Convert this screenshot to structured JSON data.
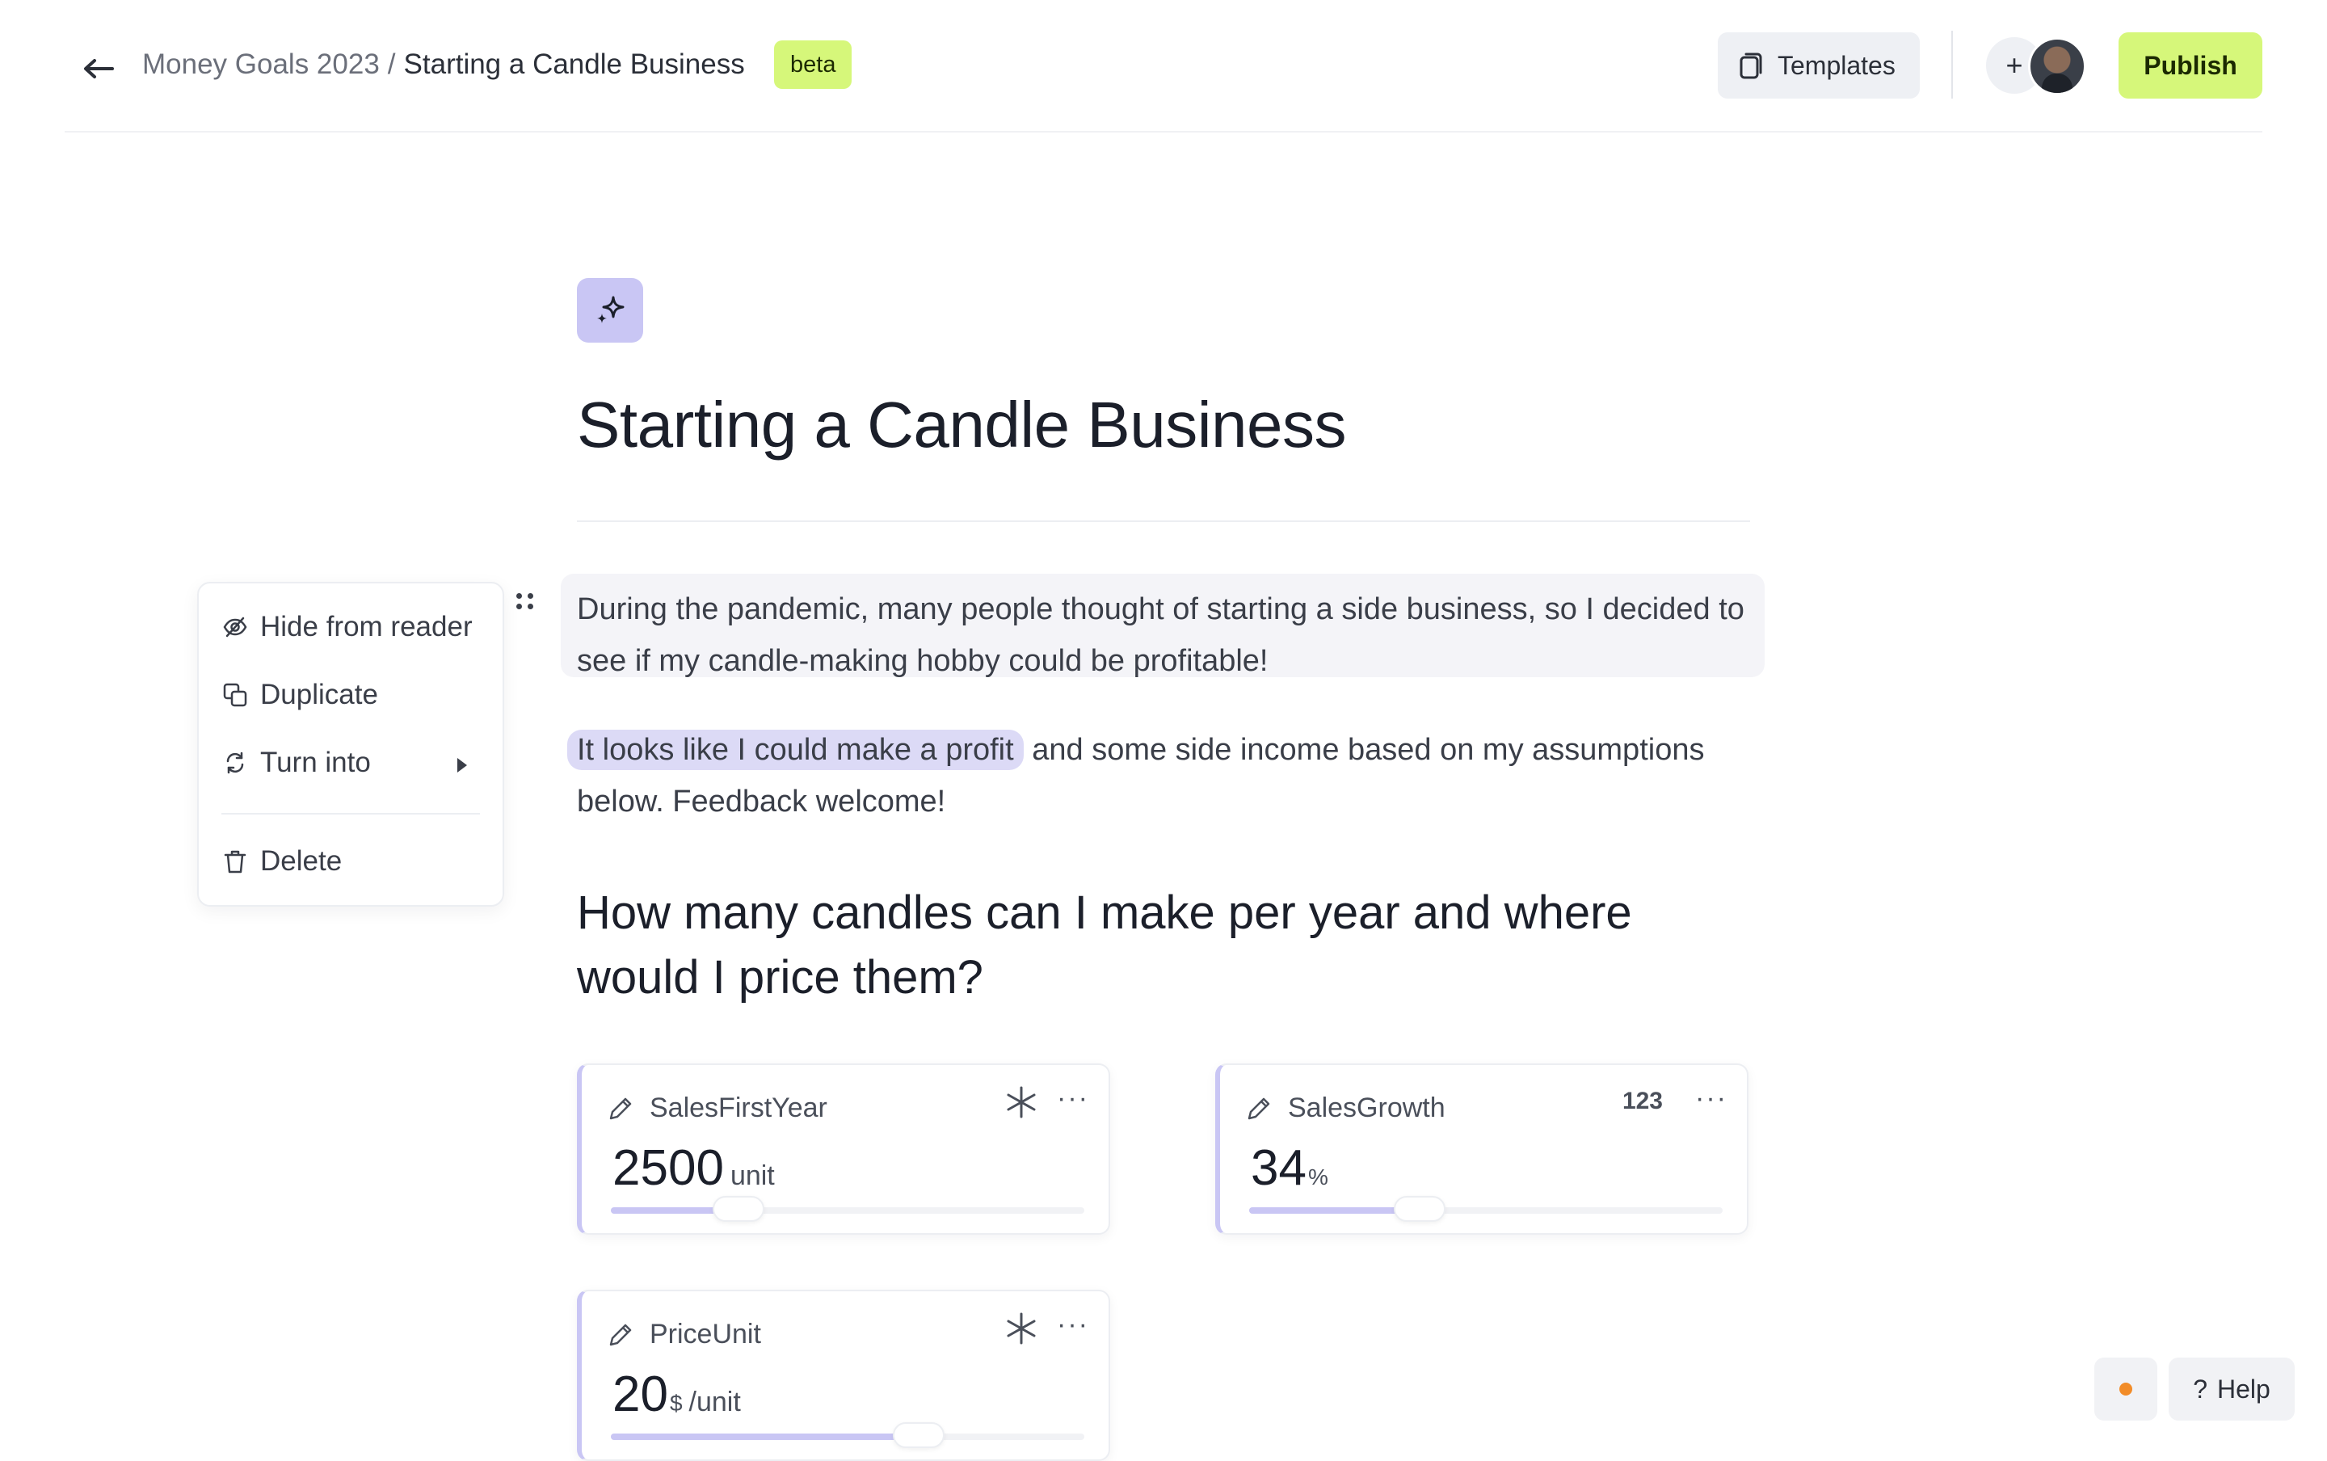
{
  "header": {
    "breadcrumb_parent": "Money Goals 2023",
    "breadcrumb_separator": "/",
    "breadcrumb_current": "Starting a Candle Business",
    "badge": "beta",
    "templates_label": "Templates",
    "add_collaborator": "+",
    "publish_label": "Publish"
  },
  "doc": {
    "icon": "sparkles-icon",
    "title": "Starting a Candle Business",
    "para1": "During the pandemic, many people thought of starting a side business, so I decided to see if my candle-making hobby could be profitable!",
    "para2_highlight": "It looks like I could make a profit",
    "para2_rest": " and some side income based on my assumptions below. Feedback welcome!",
    "heading": "How many candles can I make per year and where would I price them?"
  },
  "context_menu": {
    "items": [
      {
        "label": "Hide from reader",
        "icon": "eye-off-icon"
      },
      {
        "label": "Duplicate",
        "icon": "copy-icon"
      },
      {
        "label": "Turn into",
        "icon": "refresh-icon"
      },
      {
        "label": "Delete",
        "icon": "trash-icon"
      }
    ]
  },
  "variables": [
    {
      "name": "SalesFirstYear",
      "value": "2500",
      "unit": "unit",
      "type_icon": "asterisk-icon",
      "slider_fraction": 0.27
    },
    {
      "name": "SalesGrowth",
      "value": "34",
      "unit": "%",
      "type_label": "123",
      "slider_fraction": 0.36
    },
    {
      "name": "PriceUnit",
      "value": "20",
      "unit_prefix": "$",
      "unit": "/unit",
      "type_icon": "asterisk-icon",
      "slider_fraction": 0.65
    }
  ],
  "more_label": "···",
  "help_label": "Help",
  "colors": {
    "accent_lime": "#d6f77a",
    "accent_lavender": "#c9c6f4",
    "status_dot": "#f28c28"
  }
}
